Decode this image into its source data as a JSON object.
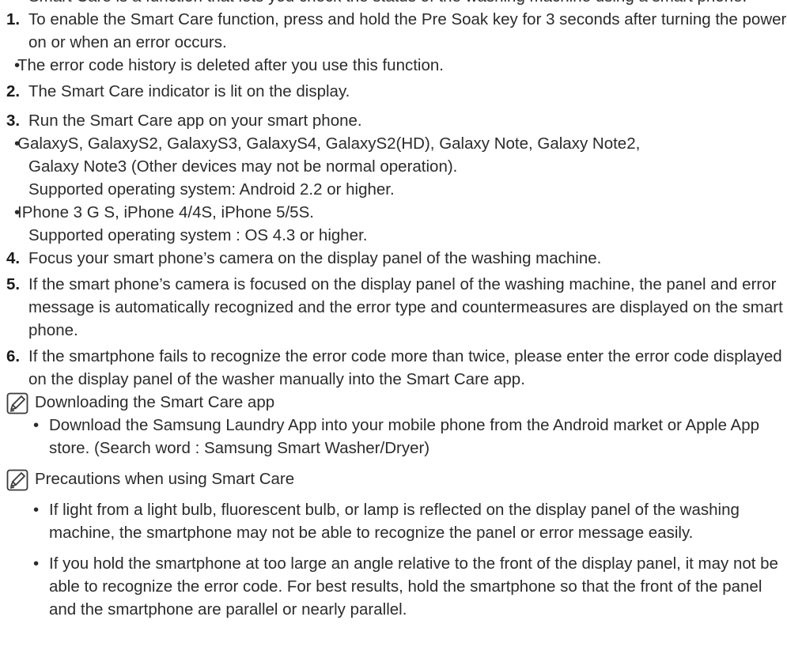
{
  "top_fragment": "Smart Care is a function that lets you check the status of the washing machine using a smart phone.",
  "steps": [
    {
      "num": "1.",
      "text": "To enable the Smart Care function, press and hold the Pre Soak key for 3 seconds after turning the power on or when an error occurs.",
      "bullet": "The error code history is deleted after you use this function."
    },
    {
      "num": "2.",
      "text": "The Smart Care indicator is lit on the display."
    },
    {
      "num": "3.",
      "text": "Run the Smart Care app on your smart phone.",
      "android_devices": "GalaxyS, GalaxyS2, GalaxyS3, GalaxyS4, GalaxyS2(HD), Galaxy Note, Galaxy Note2,",
      "android_devices_cont": "Galaxy Note3 (Other devices may not be normal operation).",
      "android_os": "Supported operating system: Android 2.2 or higher.",
      "ios_devices": "IPhone 3 G S, iPhone 4/4S, iPhone 5/5S.",
      "ios_os": "Supported operating system : OS 4.3 or higher."
    },
    {
      "num": "4.",
      "text": "Focus your smart phone’s camera on the display panel of the washing machine."
    },
    {
      "num": "5.",
      "text": "If the smart phone’s camera is focused on the display panel of the washing machine, the panel and error message is automatically recognized and the error type and countermeasures are displayed on the smart phone."
    },
    {
      "num": "6.",
      "text": "If the smartphone fails to recognize the error code more than twice, please enter the error code displayed on the display panel of the washer manually into the Smart Care app."
    }
  ],
  "notes": [
    {
      "title": "Downloading the Smart Care app",
      "bullets": [
        "Download the Samsung Laundry App into your mobile phone from the Android market or Apple App store. (Search word : Samsung Smart Washer/Dryer)"
      ]
    },
    {
      "title": "Precautions when using Smart Care",
      "bullets": [
        "If light from a light bulb, fluorescent bulb, or lamp is reflected on the display panel of the washing machine, the smartphone may not be able to recognize the panel or error message easily.",
        "If you hold the smartphone at too large an angle relative to the front of the display panel, it may not be able to recognize the error code. For best results, hold the smartphone so that the front of the panel and the smartphone are parallel or nearly parallel."
      ]
    }
  ],
  "bullet_glyph": "•"
}
